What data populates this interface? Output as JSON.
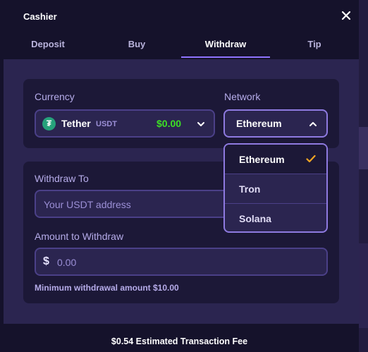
{
  "modal": {
    "title": "Cashier"
  },
  "tabs": [
    {
      "label": "Deposit",
      "active": false
    },
    {
      "label": "Buy",
      "active": false
    },
    {
      "label": "Withdraw",
      "active": true
    },
    {
      "label": "Tip",
      "active": false
    }
  ],
  "currency": {
    "label": "Currency",
    "name": "Tether",
    "code": "USDT",
    "balance": "$0.00",
    "icon": "tether-icon"
  },
  "network": {
    "label": "Network",
    "selected": "Ethereum",
    "options": [
      "Ethereum",
      "Tron",
      "Solana"
    ]
  },
  "withdraw_to": {
    "label": "Withdraw To",
    "placeholder": "Your USDT address",
    "value": ""
  },
  "amount": {
    "label": "Amount to Withdraw",
    "currency_symbol": "$",
    "placeholder": "0.00",
    "value": "",
    "minimum_note": "Minimum withdrawal amount $10.00"
  },
  "footer": {
    "fee_text": "$0.54 Estimated Transaction Fee"
  },
  "colors": {
    "accent": "#8f73ff",
    "balance_green": "#3de025",
    "check_orange": "#f5a623",
    "tether_green": "#26a17b"
  }
}
